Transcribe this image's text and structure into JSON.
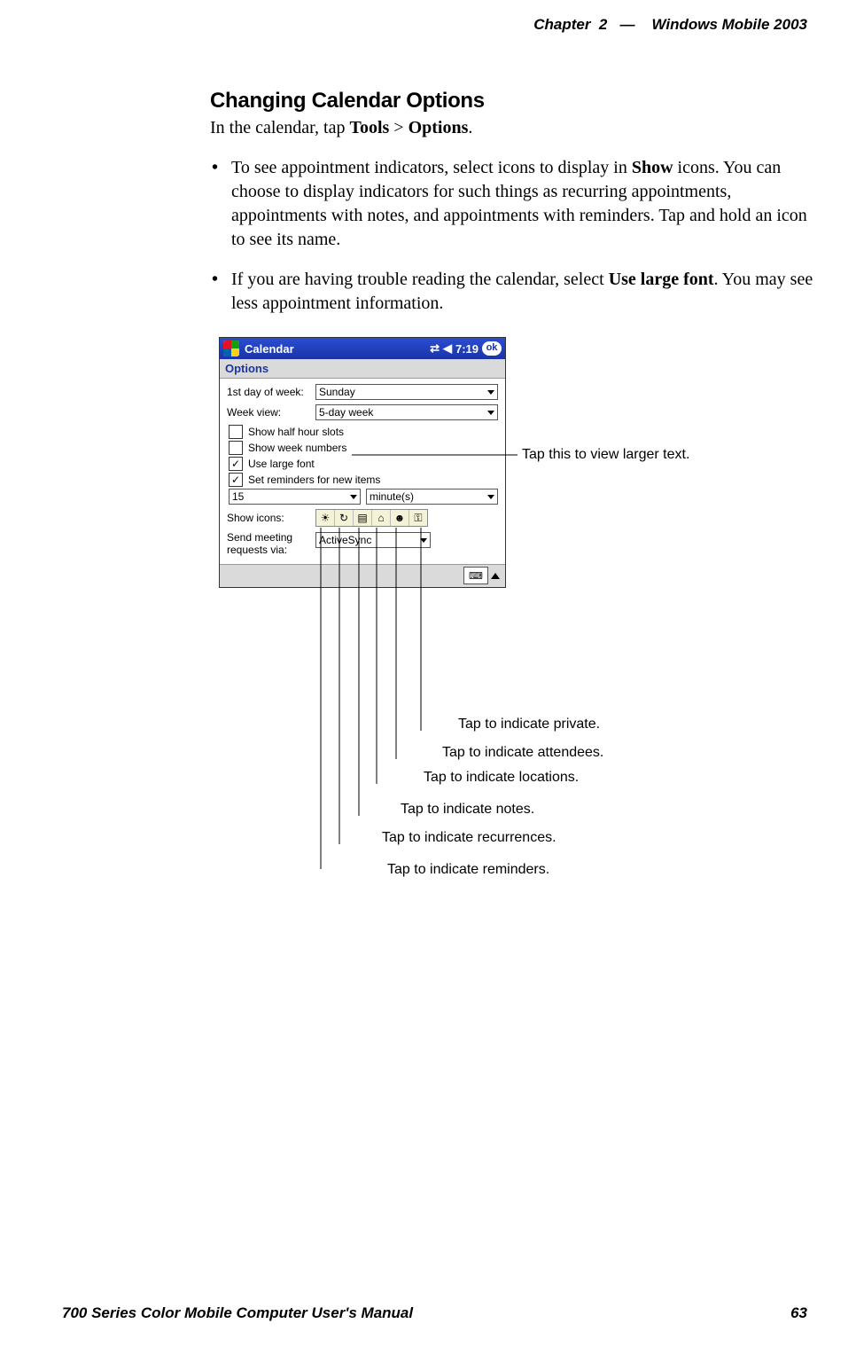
{
  "header": {
    "chapter": "Chapter",
    "chapter_num": "2",
    "dash": "—",
    "product": "Windows Mobile 2003"
  },
  "heading": "Changing Calendar Options",
  "intro_pre": "In the calendar, tap ",
  "intro_tools": "Tools",
  "intro_gt": " > ",
  "intro_options": "Options",
  "intro_post": ".",
  "bullet1": {
    "a": "To see appointment indicators, select icons to display in ",
    "b": "Show",
    "c": " icons. You can choose to display indicators for such things as recurring appointments, appointments with notes, and appointments with reminders. Tap and hold an icon to see its name."
  },
  "bullet2": {
    "a": "If you are having trouble reading the calendar, select ",
    "b": "Use large font",
    "c": ". You may see less appointment information."
  },
  "device": {
    "title": "Calendar",
    "time": "7:19",
    "ok": "ok",
    "options_label": "Options",
    "first_day_label": "1st day of week:",
    "first_day_value": "Sunday",
    "week_view_label": "Week view:",
    "week_view_value": "5-day week",
    "chk_half_hour": "Show half hour slots",
    "chk_week_numbers": "Show week numbers",
    "chk_large_font": "Use large font",
    "chk_reminders": "Set reminders for new items",
    "reminder_num": "15",
    "reminder_unit": "minute(s)",
    "show_icons_label": "Show icons:",
    "icons": [
      "☀",
      "↻",
      "▤",
      "⌂",
      "☻",
      "⚿"
    ],
    "send_label": "Send meeting requests via:",
    "send_value": "ActiveSync"
  },
  "callouts": {
    "large_font": "Tap this to view larger text.",
    "private": "Tap to indicate private.",
    "attendees": "Tap to indicate attendees.",
    "locations": "Tap to indicate locations.",
    "notes": "Tap to indicate notes.",
    "recurrences": "Tap to indicate recurrences.",
    "reminders": "Tap to indicate reminders."
  },
  "footer": {
    "manual": "700 Series Color Mobile Computer User's Manual",
    "page": "63"
  }
}
